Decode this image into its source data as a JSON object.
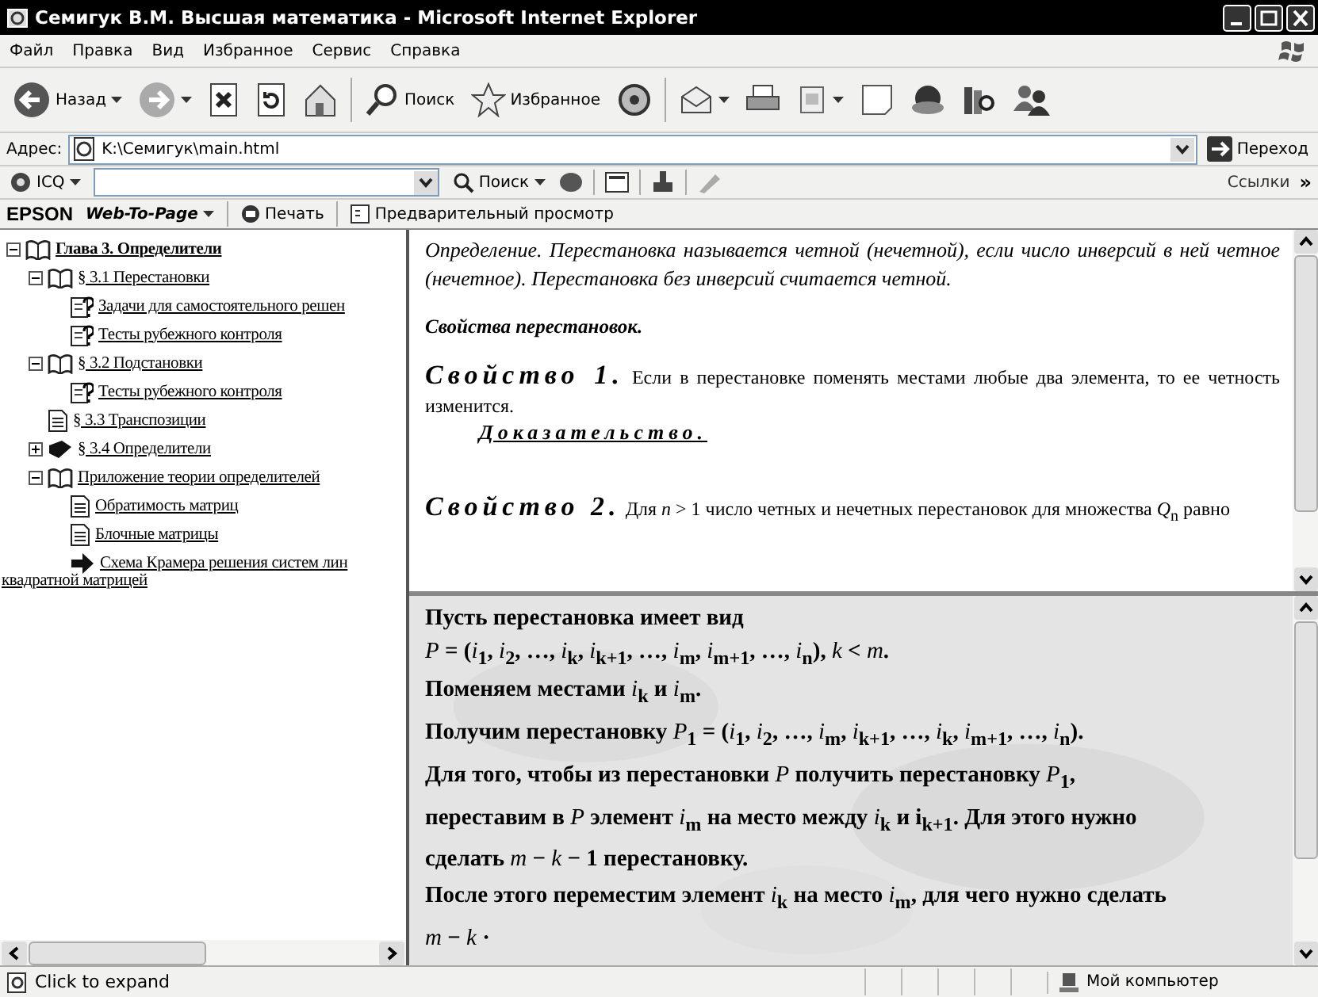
{
  "window": {
    "title": "Семигук В.М. Высшая математика - Microsoft Internet Explorer"
  },
  "menu": [
    "Файл",
    "Правка",
    "Вид",
    "Избранное",
    "Сервис",
    "Справка"
  ],
  "toolbar": [
    {
      "kind": "back",
      "label": "Назад",
      "dropdown": true
    },
    {
      "kind": "forward",
      "dropdown": true
    },
    {
      "kind": "stop",
      "dropdown": false
    },
    {
      "kind": "refresh",
      "dropdown": false
    },
    {
      "kind": "home",
      "dropdown": false
    },
    {
      "kind": "sep"
    },
    {
      "kind": "search",
      "label": "Поиск",
      "dropdown": false
    },
    {
      "kind": "favorites",
      "label": "Избранное",
      "dropdown": false
    },
    {
      "kind": "media",
      "dropdown": false
    },
    {
      "kind": "sep"
    },
    {
      "kind": "mail",
      "dropdown": true
    },
    {
      "kind": "print",
      "dropdown": false
    },
    {
      "kind": "edit",
      "dropdown": true
    },
    {
      "kind": "discuss",
      "dropdown": false
    },
    {
      "kind": "globe",
      "dropdown": false
    },
    {
      "kind": "research",
      "dropdown": false
    },
    {
      "kind": "messenger",
      "dropdown": false
    }
  ],
  "address": {
    "label": "Адрес:",
    "value": "K:\\Семигук\\main.html",
    "go": "Переход"
  },
  "icq_bar": {
    "label": "ICQ",
    "search": "Поиск",
    "links": "Ссылки",
    "more": "»"
  },
  "epson_bar": {
    "brand": "EPSON",
    "web_to_page": "Web-To-Page",
    "print": "Печать",
    "preview": "Предварительный просмотр"
  },
  "tree": [
    {
      "text": "Глава 3. Определители",
      "kind": "book",
      "expanded": true,
      "bold": true,
      "children": [
        {
          "text": "§ 3.1 Перестановки",
          "kind": "book",
          "expanded": true,
          "bold": false,
          "children": [
            {
              "text": "Задачи для самостоятельного решен",
              "kind": "help",
              "bold": false
            },
            {
              "text": "Тесты рубежного контроля",
              "kind": "help",
              "bold": false
            }
          ]
        },
        {
          "text": "§ 3.2 Подстановки",
          "kind": "book",
          "expanded": true,
          "bold": false,
          "children": [
            {
              "text": "Тесты рубежного контроля",
              "kind": "help",
              "bold": false
            }
          ]
        },
        {
          "text": "§ 3.3 Транспозиции",
          "kind": "page",
          "bold": false
        },
        {
          "text": "§ 3.4 Определители",
          "kind": "book",
          "expanded": false,
          "bold": false
        },
        {
          "text": "Приложение теории определителей",
          "kind": "book",
          "expanded": true,
          "bold": false,
          "children": [
            {
              "text": "Обратимость матриц",
              "kind": "page",
              "bold": false
            },
            {
              "text": "Блочные матрицы",
              "kind": "page",
              "bold": false
            },
            {
              "text": "Схема Крамера решения систем лин",
              "continuation": "квадратной матрицей",
              "kind": "arrow",
              "bold": false
            }
          ]
        }
      ]
    }
  ],
  "top_frame": {
    "definition": "Определение. Перестановка называется четной (нечетной),  если число инверсий в ней четное (нечетное). Перестановка без  инверсий считается четной.",
    "heading": "Свойства перестановок.",
    "properties": [
      {
        "title": "Свойство 1.",
        "text": "Если в перестановке поменять местами любые два элемента, то ее      четность изменится.",
        "proof": "Доказательство."
      },
      {
        "title": "Свойство 2.",
        "text": "Для *n* > 1 число четных  и нечетных перестановок для множества *Q*$_{n}$ равно"
      }
    ]
  },
  "bottom_frame": {
    "paragraphs": [
      "Пусть перестановка имеет вид",
      "*P* = (*i*$_{1}$, *i*$_{2}$, …, *i*$_{k}$, *i*$_{k+1}$, …, *i*$_{m}$, *i*$_{m+1}$, …, *i*$_{n}$), *k* < *m*.",
      "Поменяем местами *i*$_{k}$ и *i*$_{m}$.",
      "Получим перестановку *P*$_{1}$ = (*i*$_{1}$, *i*$_{2}$, …, *i*$_{m}$, *i*$_{k+1}$, …, *i*$_{k}$, *i*$_{m+1}$, …, *i*$_{n}$).",
      "Для того, чтобы из перестановки *P* получить перестановку *P*$_{1}$,",
      "переставим в  *P*  элемент *i*$_{m}$ на место между *i*$_{k}$ и i$_{k+1}$. Для этого  нужно",
      "сделать *m* − *k* − 1 перестановку.",
      "После этого переместим элемент *i*$_{k}$ на место *i*$_{m}$, для чего нужно сделать",
      "*m* − *k* ·"
    ]
  },
  "status_bar": {
    "text": "Click to expand",
    "zone": "Мой компьютер"
  }
}
